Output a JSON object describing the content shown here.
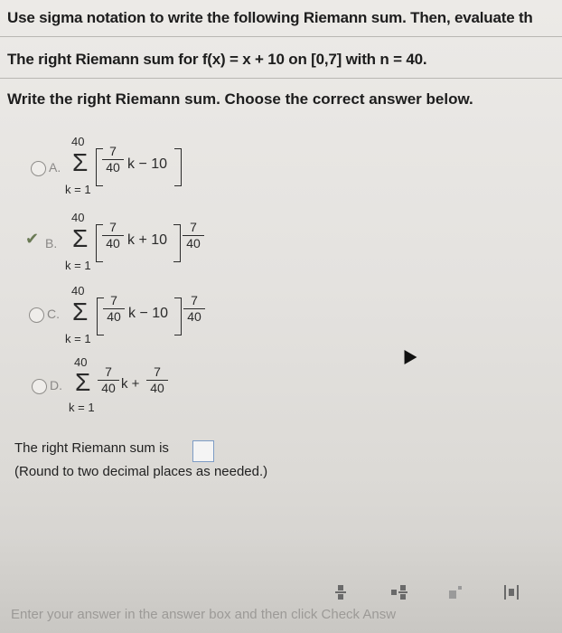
{
  "question": {
    "line1": "Use sigma notation to write the following Riemann sum. Then, evaluate th",
    "line2": "The right Riemann sum for f(x) = x + 10 on [0,7] with n = 40.",
    "instruction": "Write the right Riemann sum. Choose the correct answer below."
  },
  "options": [
    {
      "letter": "A.",
      "upper": "40",
      "lower": "k = 1",
      "frac_num": "7",
      "frac_den": "40",
      "body": "k − 10",
      "outer_num": "",
      "outer_den": "",
      "selected": false
    },
    {
      "letter": "B.",
      "upper": "40",
      "lower": "k = 1",
      "frac_num": "7",
      "frac_den": "40",
      "body": "k + 10",
      "outer_num": "7",
      "outer_den": "40",
      "selected": true
    },
    {
      "letter": "C.",
      "upper": "40",
      "lower": "k = 1",
      "frac_num": "7",
      "frac_den": "40",
      "body": "k − 10",
      "outer_num": "7",
      "outer_den": "40",
      "selected": false
    },
    {
      "letter": "D.",
      "upper": "40",
      "lower": "k = 1",
      "frac_num": "7",
      "frac_den": "40",
      "body": "k +",
      "outer_num": "7",
      "outer_den": "40",
      "selected": false
    }
  ],
  "answer": {
    "prompt": "The right Riemann sum is",
    "value": "",
    "note": "(Round to two decimal places as needed.)"
  },
  "footer": {
    "hint": "Enter your answer in the answer box and then click Check Answ"
  },
  "icons": [
    "fraction-icon",
    "mixed-number-icon",
    "exponent-icon",
    "absolute-value-icon"
  ]
}
